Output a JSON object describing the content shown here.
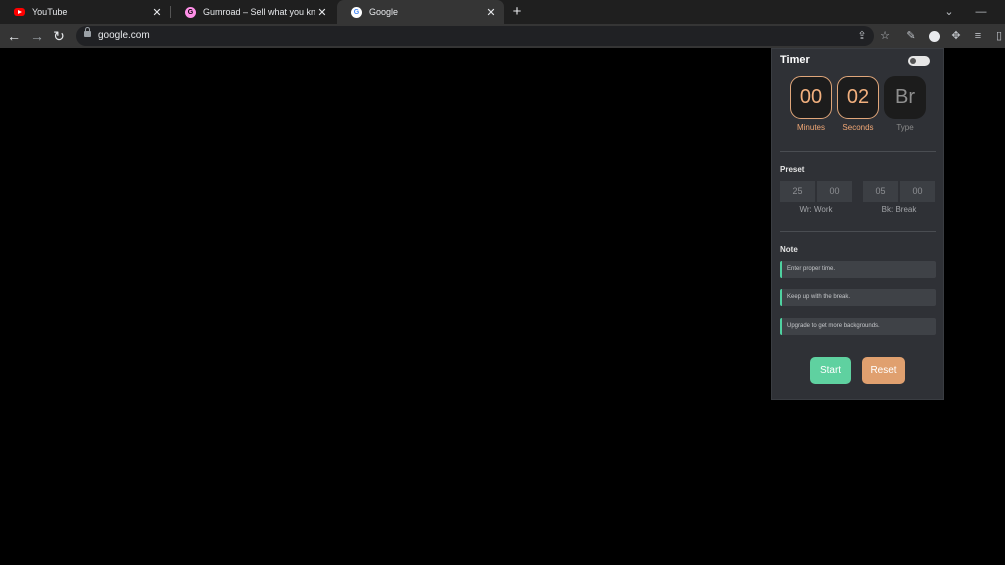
{
  "tabs": [
    {
      "title": "YouTube",
      "icon": "youtube-icon"
    },
    {
      "title": "Gumroad – Sell what you know and",
      "icon": "gumroad-icon"
    },
    {
      "title": "Google",
      "icon": "google-icon",
      "active": true
    }
  ],
  "toolbar": {
    "url": "google.com"
  },
  "timer": {
    "title": "Timer",
    "enabled": false,
    "minutes": "00",
    "seconds": "02",
    "type": "Br",
    "minutes_label": "Minutes",
    "seconds_label": "Seconds",
    "type_label": "Type"
  },
  "preset": {
    "label": "Preset",
    "work": {
      "minutes": "25",
      "seconds": "00",
      "label": "Wr: Work"
    },
    "break": {
      "minutes": "05",
      "seconds": "00",
      "label": "Bk: Break"
    }
  },
  "notes": {
    "label": "Note",
    "items": [
      "Enter proper time.",
      "Keep up with the break.",
      "Upgrade to get more backgrounds."
    ]
  },
  "buttons": {
    "start": "Start",
    "reset": "Reset"
  },
  "colors": {
    "accent_orange": "#e0a06f",
    "accent_green": "#5fd1a0",
    "panel_bg": "#2f3136"
  }
}
